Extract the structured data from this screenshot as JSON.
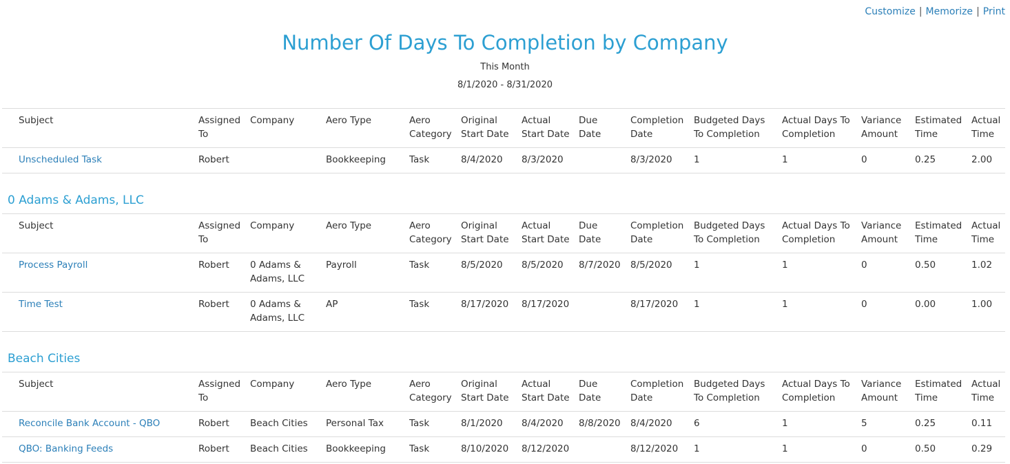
{
  "toplinks": {
    "customize": "Customize",
    "memorize": "Memorize",
    "print": "Print",
    "separator": "|"
  },
  "report": {
    "title": "Number Of Days To Completion by Company",
    "period": "This Month",
    "date_range": "8/1/2020 - 8/31/2020"
  },
  "columns": {
    "subject": "Subject",
    "assigned_1": "Assigned",
    "assigned_2": "To",
    "company": "Company",
    "aero_type": "Aero Type",
    "aero_cat_1": "Aero",
    "aero_cat_2": "Category",
    "orig_1": "Original",
    "orig_2": "Start Date",
    "actual_start_1": "Actual",
    "actual_start_2": "Start Date",
    "due_1": "Due",
    "due_2": "Date",
    "completion_1": "Completion",
    "completion_2": "Date",
    "budgeted_1": "Budgeted Days",
    "budgeted_2": "To Completion",
    "actual_days_1": "Actual Days To",
    "actual_days_2": "Completion",
    "variance_1": "Variance",
    "variance_2": "Amount",
    "est_1": "Estimated",
    "est_2": "Time",
    "act_time_1": "Actual",
    "act_time_2": "Time"
  },
  "groups": {
    "g0": {
      "rows": {
        "r0": {
          "subject": "Unscheduled Task",
          "assigned": "Robert",
          "company_1": "",
          "company_2": "",
          "aero_type": "Bookkeeping",
          "aero_category": "Task",
          "original_start": "8/4/2020",
          "actual_start": "8/3/2020",
          "due": "",
          "completion": "8/3/2020",
          "budgeted": "1",
          "actual_days": "1",
          "variance": "0",
          "estimated": "0.25",
          "actual_time": "2.00"
        }
      }
    },
    "g1": {
      "name": "0 Adams & Adams, LLC",
      "rows": {
        "r0": {
          "subject": "Process Payroll",
          "assigned": "Robert",
          "company_1": "0 Adams &",
          "company_2": "Adams, LLC",
          "aero_type": "Payroll",
          "aero_category": "Task",
          "original_start": "8/5/2020",
          "actual_start": "8/5/2020",
          "due": "8/7/2020",
          "completion": "8/5/2020",
          "budgeted": "1",
          "actual_days": "1",
          "variance": "0",
          "estimated": "0.50",
          "actual_time": "1.02"
        },
        "r1": {
          "subject": "Time Test",
          "assigned": "Robert",
          "company_1": "0 Adams &",
          "company_2": "Adams, LLC",
          "aero_type": "AP",
          "aero_category": "Task",
          "original_start": "8/17/2020",
          "actual_start": "8/17/2020",
          "due": "",
          "completion": "8/17/2020",
          "budgeted": "1",
          "actual_days": "1",
          "variance": "0",
          "estimated": "0.00",
          "actual_time": "1.00"
        }
      }
    },
    "g2": {
      "name": "Beach Cities",
      "rows": {
        "r0": {
          "subject": "Reconcile Bank Account - QBO",
          "assigned": "Robert",
          "company_1": "Beach Cities",
          "company_2": "",
          "aero_type": "Personal Tax",
          "aero_category": "Task",
          "original_start": "8/1/2020",
          "actual_start": "8/4/2020",
          "due": "8/8/2020",
          "completion": "8/4/2020",
          "budgeted": "6",
          "actual_days": "1",
          "variance": "5",
          "estimated": "0.25",
          "actual_time": "0.11"
        },
        "r1": {
          "subject": "QBO: Banking Feeds",
          "assigned": "Robert",
          "company_1": "Beach Cities",
          "company_2": "",
          "aero_type": "Bookkeeping",
          "aero_category": "Task",
          "original_start": "8/10/2020",
          "actual_start": "8/12/2020",
          "due": "",
          "completion": "8/12/2020",
          "budgeted": "1",
          "actual_days": "1",
          "variance": "0",
          "estimated": "0.50",
          "actual_time": "0.29"
        }
      }
    }
  }
}
